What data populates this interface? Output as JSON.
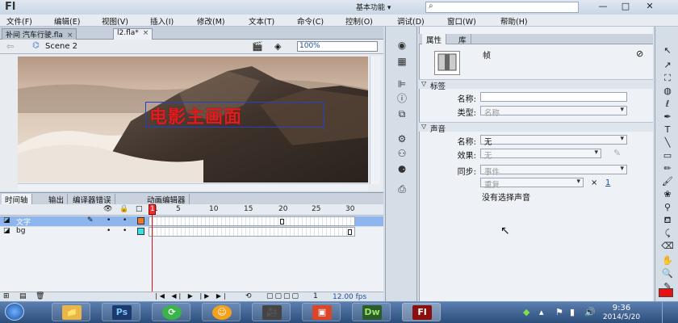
{
  "app": {
    "logo": "Fl",
    "workspace": "基本功能 ▾",
    "search_icon": "⌕",
    "minimize": "—",
    "maximize": "□",
    "close": "✕"
  },
  "menu": [
    "文件(F)",
    "编辑(E)",
    "视图(V)",
    "插入(I)",
    "修改(M)",
    "文本(T)",
    "命令(C)",
    "控制(O)",
    "调试(D)",
    "窗口(W)",
    "帮助(H)"
  ],
  "doc_tabs": [
    {
      "label": "补间 汽车行驶.fla",
      "active": false
    },
    {
      "label": "l2.fla*",
      "active": true
    }
  ],
  "edit_bar": {
    "scene": "Scene 2",
    "zoom": "100%"
  },
  "stage": {
    "headline": "电影主画面"
  },
  "timeline": {
    "tabs": [
      "时间轴",
      "输出",
      "编译器错误",
      "动画编辑器"
    ],
    "ruler": [
      "1",
      "5",
      "10",
      "15",
      "20",
      "25",
      "30"
    ],
    "layers": [
      {
        "name": "文字",
        "selected": true,
        "color": "#f07820"
      },
      {
        "name": "bg",
        "selected": false,
        "color": "#38e0e8"
      }
    ],
    "playhead": "1",
    "fps": "12.00 fps"
  },
  "properties": {
    "tabs": [
      "属性",
      "库"
    ],
    "frame_label": "帧",
    "label_section": "标签",
    "name_label": "名称:",
    "type_label": "类型:",
    "type_value": "名称",
    "sound_section": "声音",
    "sound_name_label": "名称:",
    "sound_name_value": "无",
    "effect_label": "效果:",
    "effect_value": "无",
    "sync_label": "同步:",
    "sync_value": "事件",
    "repeat_value": "重复",
    "repeat_x": "×",
    "repeat_count": "1",
    "no_sound": "没有选择声音"
  },
  "taskbar": {
    "apps": [
      "📁",
      "Ps",
      "⟳",
      "☺",
      "🎥",
      "▣",
      "Dw",
      "Fl"
    ],
    "time": "9:36",
    "date": "2014/5/20"
  },
  "colors": {
    "fill": "#e81010",
    "headline": "#e01d1d"
  }
}
